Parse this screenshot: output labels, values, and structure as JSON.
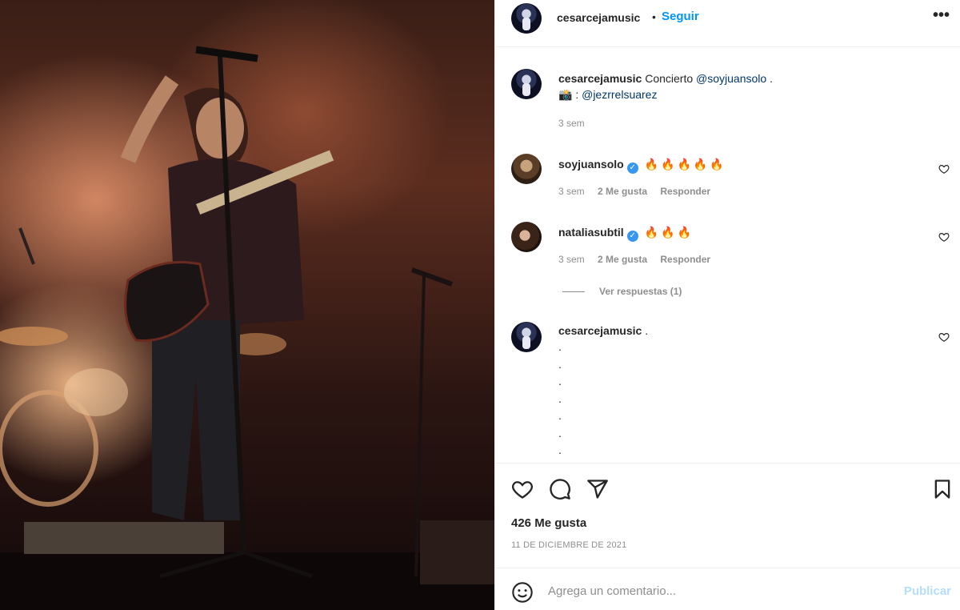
{
  "post": {
    "username": "cesarcejamusic",
    "separator": "•",
    "follow_label": "Seguir",
    "more_label": "•••",
    "photo_alt": "Concert photo"
  },
  "caption": {
    "username": "cesarcejamusic",
    "text": "Concierto",
    "mention": "@soyjuansolo",
    "suffix": " .",
    "camera_emoji": "📸",
    "colon": " : ",
    "credit": "@jezrrelsuarez",
    "time": "3 sem"
  },
  "comments": [
    {
      "username": "soyjuansolo",
      "verified": "✓",
      "text": "🔥🔥🔥🔥🔥",
      "time": "3 sem",
      "likes": "2 Me gusta",
      "reply": "Responder"
    },
    {
      "username": "nataliasubtil",
      "verified": "✓",
      "text": "🔥🔥🔥",
      "time": "3 sem",
      "likes": "2 Me gusta",
      "reply": "Responder",
      "replies_label": "Ver respuestas (1)"
    },
    {
      "username": "cesarcejamusic",
      "text": ".",
      "dots": [
        ".",
        ".",
        ".",
        ".",
        ".",
        ".",
        "."
      ]
    }
  ],
  "actions": {
    "likes": "426 Me gusta",
    "date": "11 DE DICIEMBRE DE 2021"
  },
  "add_comment": {
    "placeholder": "Agrega un comentario...",
    "publish_label": "Publicar"
  },
  "colors": {
    "accent": "#0095f6",
    "publish_disabled": "#b2dffc",
    "text": "#262626",
    "muted": "#8e8e8e"
  }
}
